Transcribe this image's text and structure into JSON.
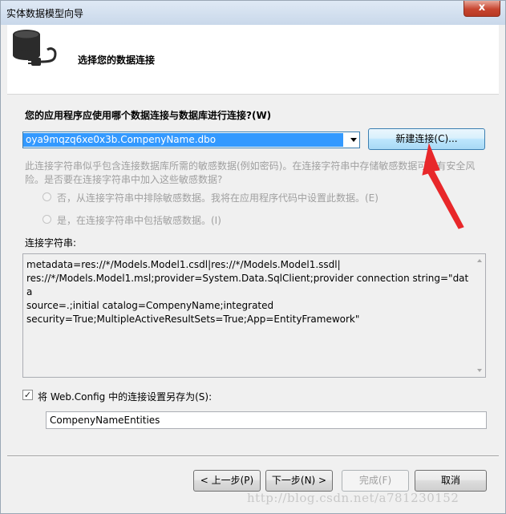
{
  "window": {
    "title": "实体数据模型向导",
    "close_glyph": "x"
  },
  "header": {
    "title": "选择您的数据连接",
    "icon": "database-plug-icon"
  },
  "question": "您的应用程序应使用哪个数据连接与数据库进行连接?(W)",
  "connection": {
    "selected": "oya9mqzq6xe0x3b.CompenyName.dbo",
    "new_button": "新建连接(C)..."
  },
  "sensitive": {
    "warning_line1": "此连接字符串似乎包含连接数据库所需的敏感数据(例如密码)。在连接字符串中存储敏感数据可能有安全风",
    "warning_line2": "险。是否要在连接字符串中加入这些敏感数据?",
    "option_exclude": "否，从连接字符串中排除敏感数据。我将在应用程序代码中设置此数据。(E)",
    "option_include": "是，在连接字符串中包括敏感数据。(I)"
  },
  "connection_string": {
    "label": "连接字符串:",
    "value": "metadata=res://*/Models.Model1.csdl|res://*/Models.Model1.ssdl|\nres://*/Models.Model1.msl;provider=System.Data.SqlClient;provider connection string=\"data\nsource=.;initial catalog=CompenyName;integrated\nsecurity=True;MultipleActiveResultSets=True;App=EntityFramework\""
  },
  "save_setting": {
    "checked": true,
    "check_glyph": "✓",
    "label": "将 Web.Config 中的连接设置另存为(S):",
    "value": "CompenyNameEntities"
  },
  "buttons": {
    "back": "< 上一步(P)",
    "next": "下一步(N) >",
    "finish": "完成(F)",
    "cancel": "取消"
  },
  "annotation_color": "#e8272a",
  "watermark": "http://blog.csdn.net/a781230152"
}
